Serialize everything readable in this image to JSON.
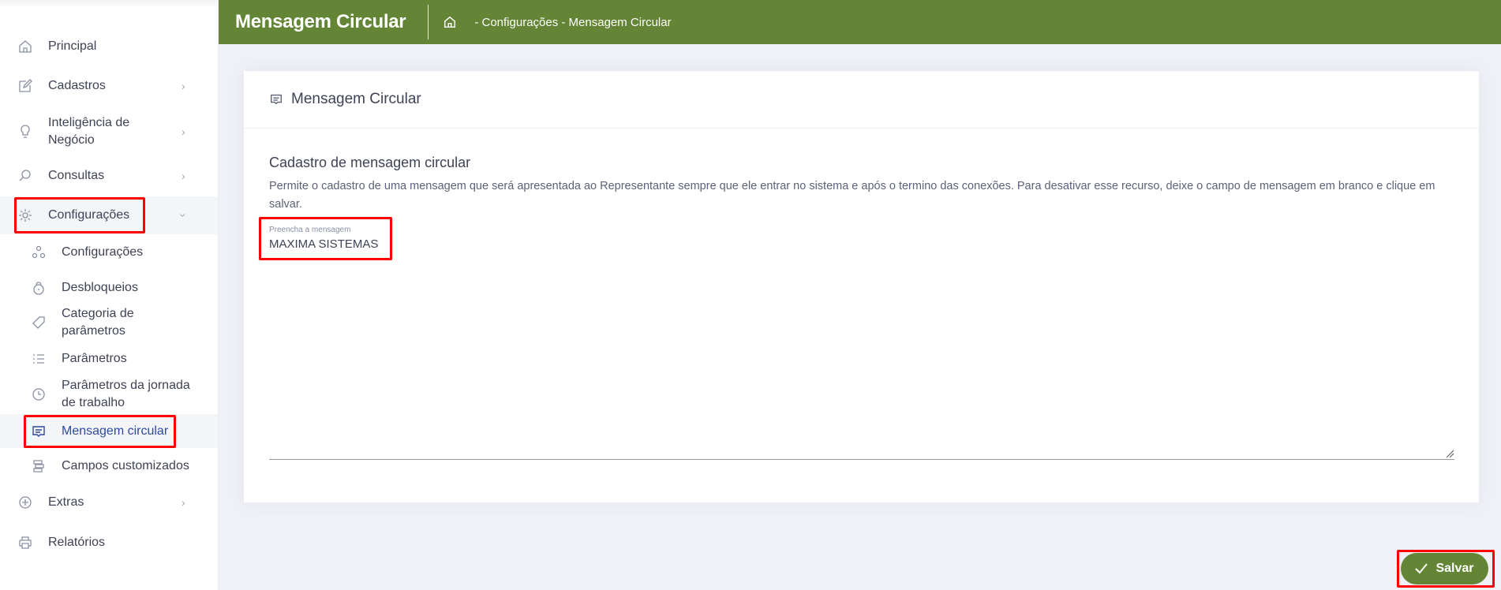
{
  "header": {
    "title": "Mensagem Circular",
    "breadcrumb": "- Configurações - Mensagem Circular"
  },
  "sidebar": {
    "items": [
      {
        "label": "Principal",
        "icon": "home-icon"
      },
      {
        "label": "Cadastros",
        "icon": "edit-icon"
      },
      {
        "label": "Inteligência de Negócio",
        "line1": "Inteligência de",
        "line2": "Negócio",
        "icon": "lightbulb-icon"
      },
      {
        "label": "Consultas",
        "icon": "search-icon"
      },
      {
        "label": "Configurações",
        "icon": "gear-icon"
      },
      {
        "label": "Extras",
        "icon": "plus-circle-icon"
      },
      {
        "label": "Relatórios",
        "icon": "printer-icon"
      }
    ],
    "subitems": [
      {
        "label": "Configurações",
        "icon": "nodes-icon"
      },
      {
        "label": "Desbloqueios",
        "icon": "unlock-icon"
      },
      {
        "line1": "Categoria de",
        "line2": "parâmetros",
        "icon": "tag-icon"
      },
      {
        "label": "Parâmetros",
        "icon": "list-icon"
      },
      {
        "line1": "Parâmetros da jornada",
        "line2": "de trabalho",
        "icon": "clock-icon"
      },
      {
        "label": "Mensagem circular",
        "icon": "message-icon"
      },
      {
        "label": "Campos customizados",
        "icon": "fields-icon"
      }
    ]
  },
  "card": {
    "title": "Mensagem Circular",
    "section_title": "Cadastro de mensagem circular",
    "description": "Permite o cadastro de uma mensagem que será apresentada ao Representante sempre que ele entrar no sistema e após o termino das conexões. Para desativar esse recurso, deixe o campo de mensagem em branco e clique em salvar.",
    "field_label": "Preencha a mensagem",
    "field_value": "MAXIMA SISTEMAS"
  },
  "actions": {
    "save_label": "Salvar"
  },
  "colors": {
    "brand": "#648535",
    "highlight": "#ff0000",
    "active": "#2e4a9e"
  }
}
